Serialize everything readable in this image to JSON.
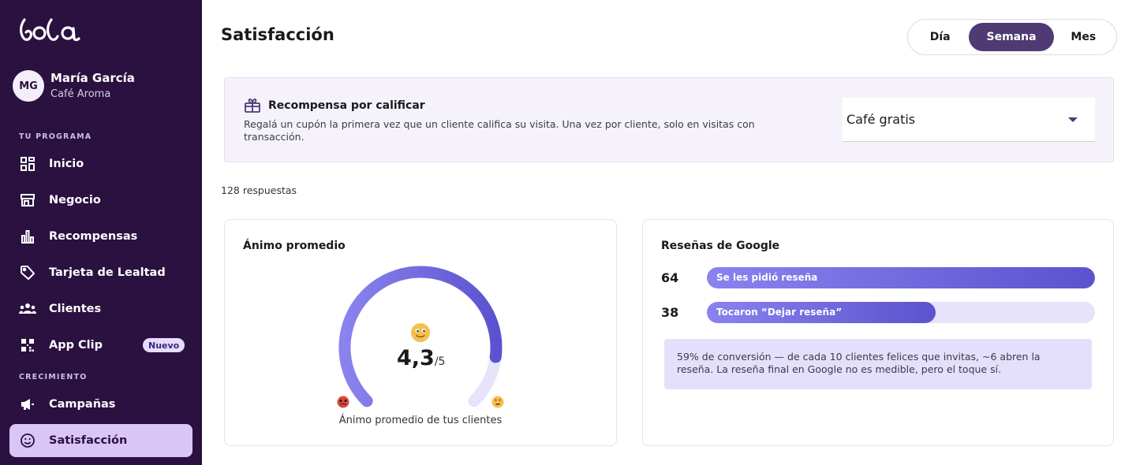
{
  "brand": {
    "logo_text": "lola"
  },
  "user": {
    "initials": "MG",
    "name": "María García",
    "business": "Café Aroma"
  },
  "sidebar": {
    "section_program": "TU PROGRAMA",
    "section_growth": "CRECIMIENTO",
    "items": [
      {
        "label": "Inicio",
        "icon": "dashboard-icon"
      },
      {
        "label": "Negocio",
        "icon": "store-icon"
      },
      {
        "label": "Recompensas",
        "icon": "bar-chart-icon"
      },
      {
        "label": "Tarjeta de Lealtad",
        "icon": "tag-icon"
      },
      {
        "label": "Clientes",
        "icon": "people-icon"
      },
      {
        "label": "App Clip",
        "icon": "qr-icon",
        "badge": "Nuevo"
      },
      {
        "label": "Campañas",
        "icon": "megaphone-icon"
      },
      {
        "label": "Satisfacción",
        "icon": "smile-icon",
        "active": true
      }
    ]
  },
  "header": {
    "title": "Satisfacción",
    "period_tabs": [
      "Día",
      "Semana",
      "Mes"
    ],
    "active_tab": "Semana"
  },
  "reward": {
    "title": "Recompensa por calificar",
    "description": "Regalá un cupón la primera vez que un cliente califica su visita. Una vez por cliente, solo en visitas con transacción.",
    "selected": "Café gratis"
  },
  "responses": "128 respuestas",
  "mood": {
    "title": "Ánimo promedio",
    "score": "4,3",
    "score_max": "/5",
    "value": 4.3,
    "max": 5,
    "caption": "Ánimo promedio de tus clientes"
  },
  "google": {
    "title": "Reseñas de Google",
    "rows": [
      {
        "count": "64",
        "label": "Se les pidió reseña",
        "fraction": 1.0
      },
      {
        "count": "38",
        "label": "Tocaron “Dejar reseña”",
        "fraction": 0.59
      }
    ],
    "note": "59% de conversión — de cada 10 clientes felices que invitas, ~6 abren la reseña. La reseña final en Google no es medible, pero el toque sí."
  },
  "colors": {
    "sidebar_bg": "#2a1140",
    "accent": "#4f3a73",
    "bar": "#5b52cf",
    "active_nav": "#d9c6f6"
  }
}
